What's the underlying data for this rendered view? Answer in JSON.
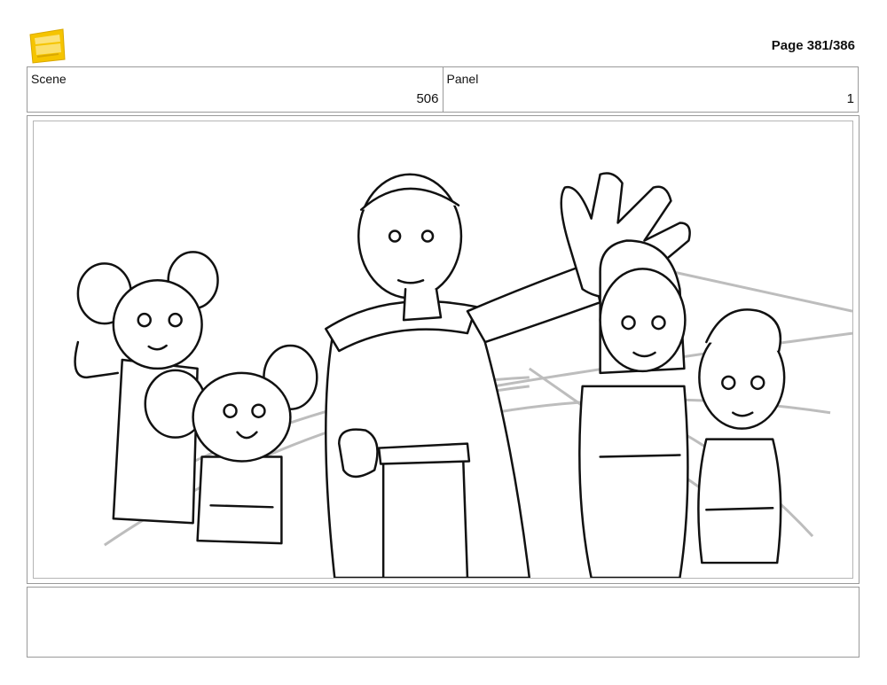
{
  "header": {
    "logo_icon": "young-jedi-adventures-logo-icon",
    "logo_color": "#F5C400",
    "page_label": "Page 381/386"
  },
  "info": {
    "scene_label": "Scene",
    "scene_value": "506",
    "panel_label": "Panel",
    "panel_value": "1"
  },
  "panel": {
    "image_description_icon": "storyboard-sketch-icon"
  },
  "notes": {
    "text": ""
  }
}
